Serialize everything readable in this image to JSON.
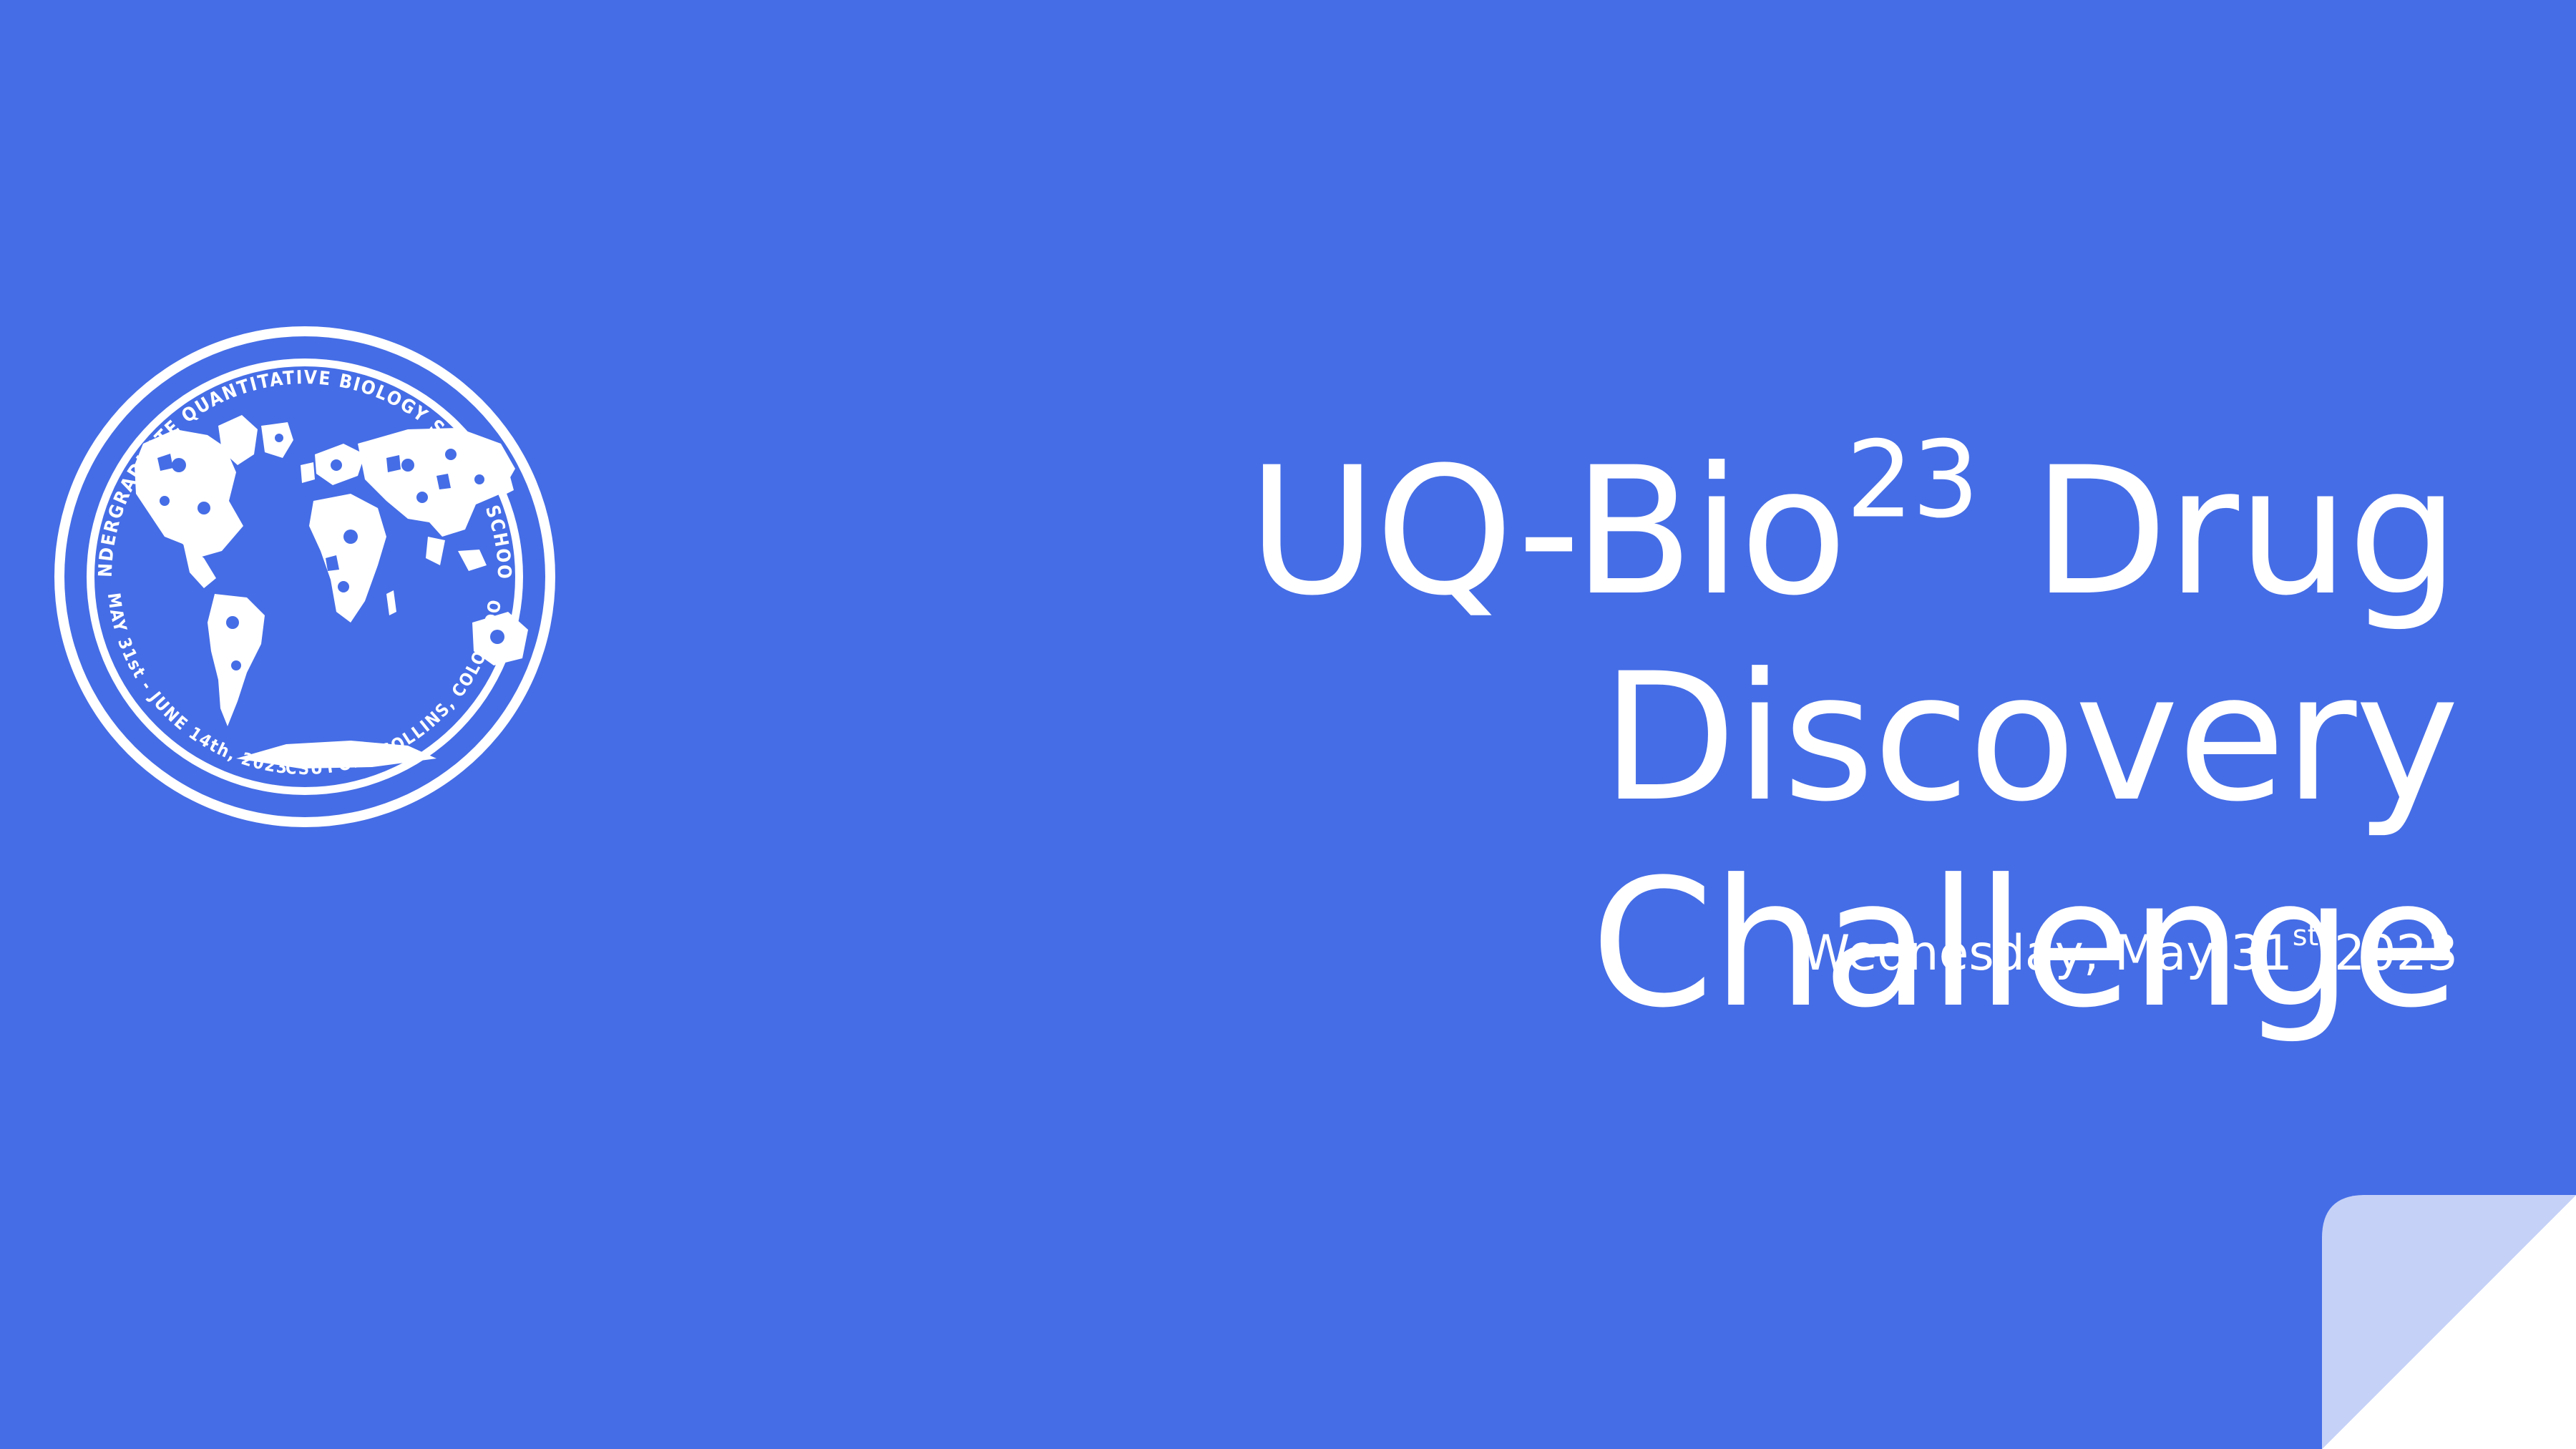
{
  "logo": {
    "icon": "uq-bio-summer-school-seal-icon",
    "ring_top": "UNDERGRADUATE QUANTITATIVE BIOLOGY SUMMER SCHOOL",
    "ring_left": "MAY 31st - JUNE 14th, 2023",
    "ring_bottom": "CSU",
    "ring_right": "FORT COLLINS, COLORADO"
  },
  "title": {
    "part1": "UQ-Bio",
    "superscript": "23",
    "part2": " Drug Discovery",
    "line2": "Challenge"
  },
  "subtitle": {
    "prefix": "Wednesday, May 31",
    "superscript": "st",
    "suffix": " 2023"
  },
  "colors": {
    "background": "#456de6",
    "text": "#ffffff",
    "corner_fold": "#c5d1f7"
  }
}
